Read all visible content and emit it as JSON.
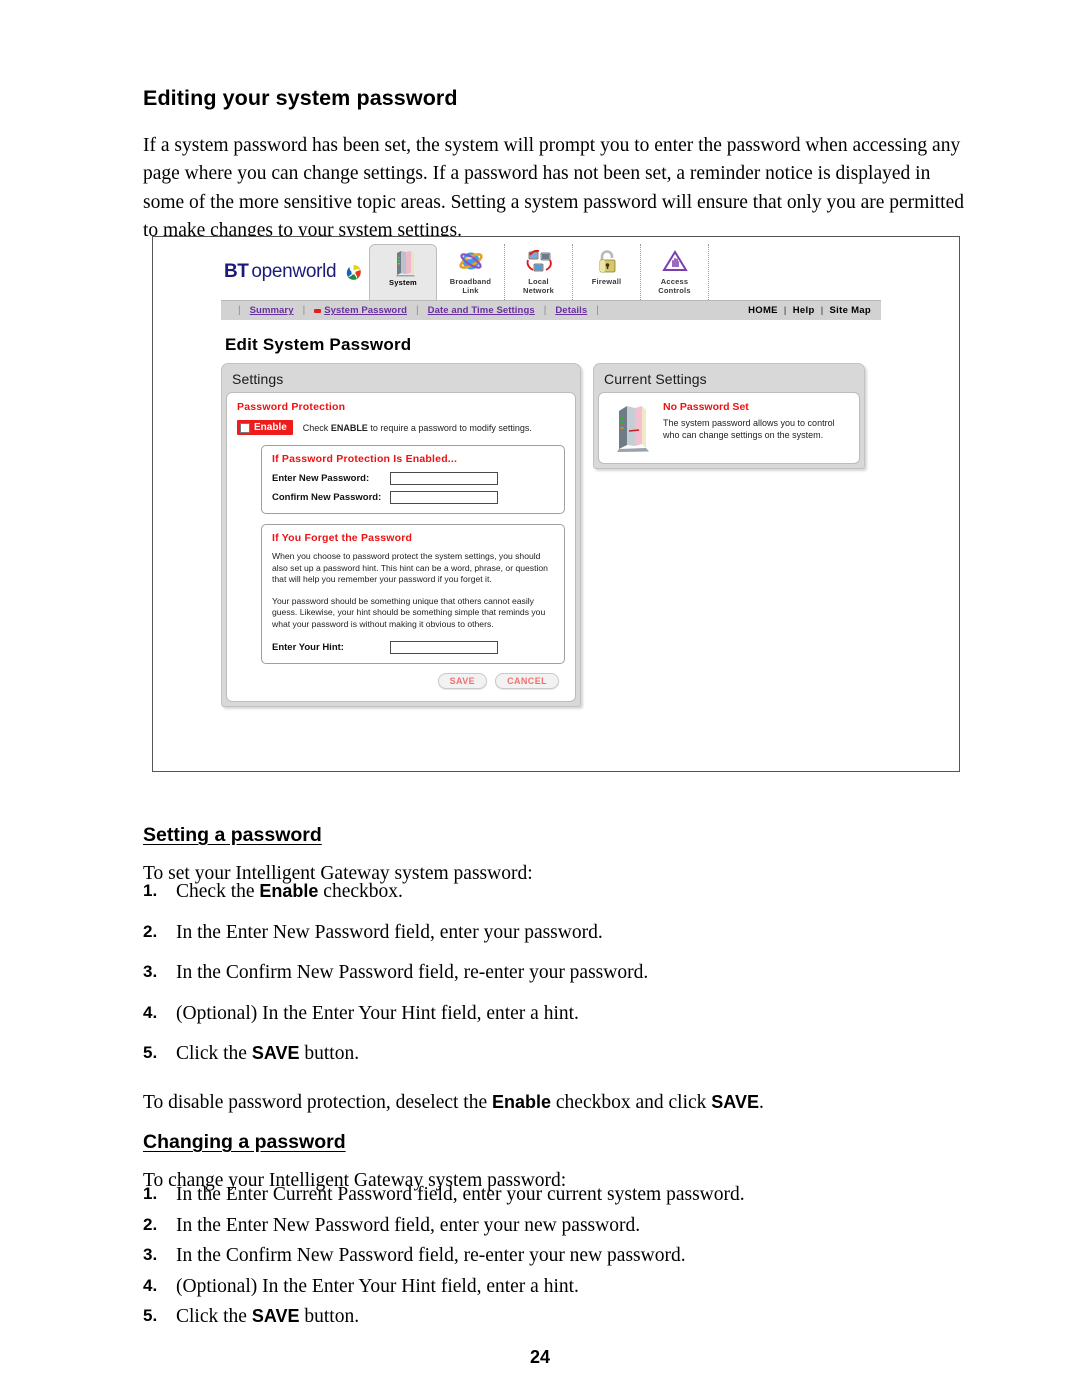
{
  "document": {
    "heading": "Editing your system password",
    "intro": "If a system password has been set, the system will prompt you to enter the password when accessing any page where you can change settings. If a password has not been set, a reminder notice is displayed in some of the more sensitive topic areas. Setting a system password will ensure that only you are permitted to make changes to your system settings.",
    "page_number": "24",
    "sections": [
      {
        "heading": "Setting a password",
        "lead": "To set your Intelligent Gateway system password:",
        "steps": [
          {
            "num": "1.",
            "prefix": "Check the ",
            "bold": "Enable",
            "suffix": " checkbox."
          },
          {
            "num": "2.",
            "prefix": "In the Enter New Password field, enter your password.",
            "bold": "",
            "suffix": ""
          },
          {
            "num": "3.",
            "prefix": "In the Confirm New Password field, re-enter your password.",
            "bold": "",
            "suffix": ""
          },
          {
            "num": "4.",
            "prefix": "(Optional) In the Enter Your Hint field, enter a hint.",
            "bold": "",
            "suffix": ""
          },
          {
            "num": "5.",
            "prefix": "Click the ",
            "bold": "SAVE",
            "suffix": " button."
          }
        ],
        "note": {
          "part1": "To disable password protection, deselect the ",
          "bold1": "Enable",
          "part2": " checkbox and click ",
          "bold2": "SAVE",
          "part3": "."
        }
      },
      {
        "heading": "Changing a password",
        "lead": "To change your Intelligent Gateway system password:",
        "steps": [
          {
            "num": "1.",
            "prefix": "In the Enter Current Password field, enter your current system password.",
            "bold": "",
            "suffix": ""
          },
          {
            "num": "2.",
            "prefix": "In the Enter New Password field, enter your new password.",
            "bold": "",
            "suffix": ""
          },
          {
            "num": "3.",
            "prefix": "In the Confirm New Password field, re-enter your new password.",
            "bold": "",
            "suffix": ""
          },
          {
            "num": "4.",
            "prefix": "(Optional) In the Enter Your Hint field, enter a hint.",
            "bold": "",
            "suffix": ""
          },
          {
            "num": "5.",
            "prefix": "Click the ",
            "bold": "SAVE",
            "suffix": " button."
          }
        ]
      }
    ]
  },
  "app": {
    "brand": {
      "bt": "BT",
      "openworld": "openworld"
    },
    "tabs": [
      {
        "label_line1": "System",
        "label_line2": "",
        "icon": "router-icon",
        "active": true
      },
      {
        "label_line1": "Broadband",
        "label_line2": "Link",
        "icon": "globe-icon",
        "active": false
      },
      {
        "label_line1": "Local",
        "label_line2": "Network",
        "icon": "network-computers-icon",
        "active": false
      },
      {
        "label_line1": "Firewall",
        "label_line2": "",
        "icon": "padlock-icon",
        "active": false
      },
      {
        "label_line1": "Access",
        "label_line2": "Controls",
        "icon": "hand-triangle-icon",
        "active": false
      }
    ],
    "subnav": {
      "links": [
        {
          "label": "Summary",
          "selected": false
        },
        {
          "label": "System Password",
          "selected": true
        },
        {
          "label": "Date and Time Settings",
          "selected": false
        },
        {
          "label": "Details",
          "selected": false
        }
      ],
      "right": [
        "HOME",
        "Help",
        "Site Map"
      ],
      "separator": "|"
    },
    "page_title": "Edit System Password",
    "settings_panel": {
      "title": "Settings",
      "password_protection_title": "Password Protection",
      "enable_label": "Enable",
      "enable_desc_prefix": "Check ",
      "enable_desc_bold": "ENABLE",
      "enable_desc_suffix": " to require a password to modify settings.",
      "enabled_box": {
        "title": "If Password Protection Is Enabled...",
        "fields": [
          {
            "label": "Enter New Password:",
            "value": ""
          },
          {
            "label": "Confirm New Password:",
            "value": ""
          }
        ]
      },
      "forgot_box": {
        "title": "If You Forget the Password",
        "paragraph1": "When you choose to password protect the system settings, you should also set up a password hint. This hint can be a word, phrase, or question that will help you remember your password if you forget it.",
        "paragraph2": "Your password should be something unique that others cannot easily guess. Likewise, your hint should be something simple that reminds you what your password is without making it obvious to others.",
        "hint_label": "Enter Your Hint:",
        "hint_value": ""
      },
      "buttons": [
        {
          "label": "SAVE"
        },
        {
          "label": "CANCEL"
        }
      ]
    },
    "current_panel": {
      "title": "Current Settings",
      "status": "No Password Set",
      "description": "The system password allows you to control who can change settings on the system.",
      "icon": "router-device-icon"
    },
    "colors": {
      "accent_red": "#ee1111",
      "link_purple": "#6a2fa0",
      "brand_blue": "#1b1b7a",
      "panel_gray": "#d8d8d8"
    }
  }
}
